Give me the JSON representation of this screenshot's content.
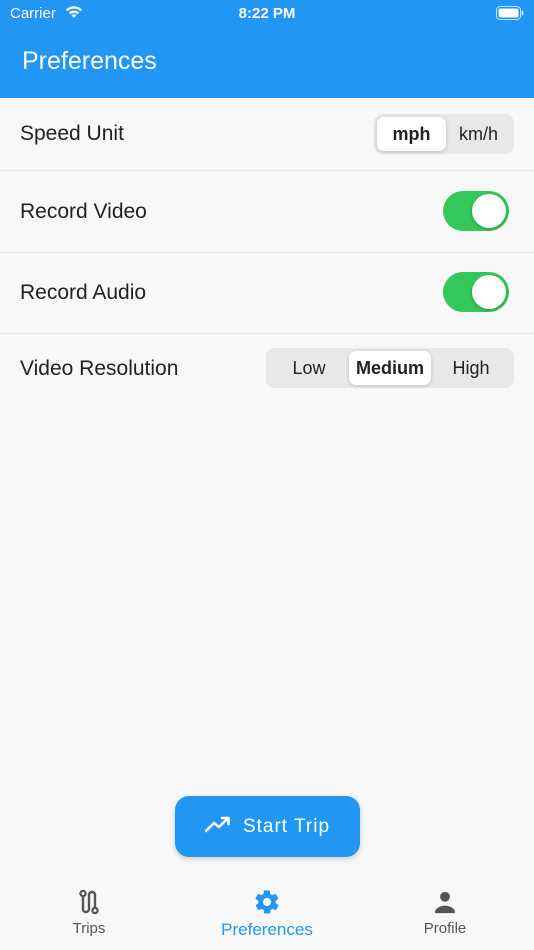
{
  "status_bar": {
    "carrier": "Carrier",
    "time": "8:22 PM"
  },
  "app_bar": {
    "title": "Preferences"
  },
  "settings": {
    "speed_unit": {
      "label": "Speed Unit",
      "options": [
        "mph",
        "km/h"
      ],
      "selected": "mph"
    },
    "record_video": {
      "label": "Record Video",
      "enabled": true
    },
    "record_audio": {
      "label": "Record Audio",
      "enabled": true
    },
    "video_resolution": {
      "label": "Video Resolution",
      "options": [
        "Low",
        "Medium",
        "High"
      ],
      "selected": "Medium"
    }
  },
  "start_trip": {
    "label": "Start Trip",
    "icon": "trending-up-icon"
  },
  "bottom_nav": {
    "items": [
      {
        "label": "Trips",
        "icon": "route-icon"
      },
      {
        "label": "Preferences",
        "icon": "gear-icon"
      },
      {
        "label": "Profile",
        "icon": "person-icon"
      }
    ],
    "active": "Preferences"
  },
  "colors": {
    "primary": "#2196f3",
    "toggle_on": "#34c759",
    "background": "#f8f8f8"
  }
}
